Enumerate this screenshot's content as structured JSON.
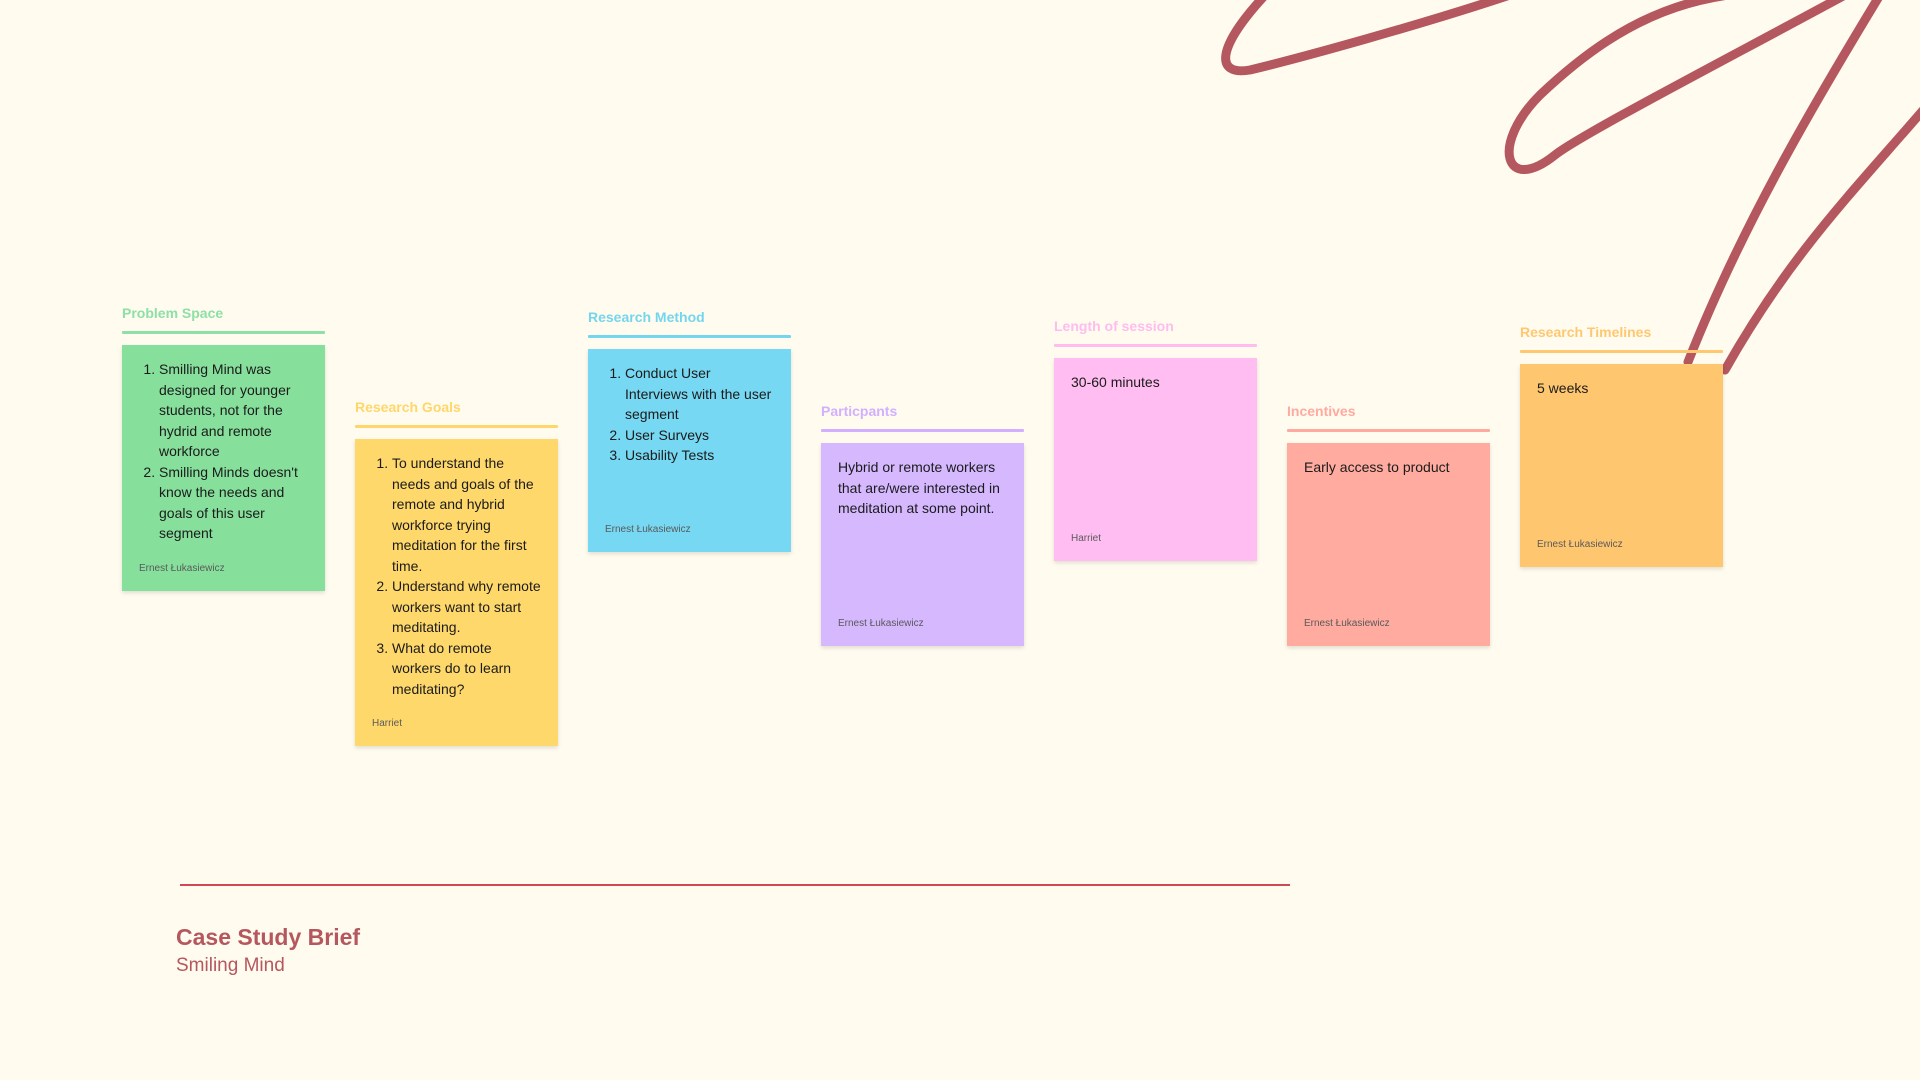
{
  "colors": {
    "background": "#fffbee",
    "scribble": "#b5575e",
    "brief_rule": "#d04a55",
    "brief_text": "#b5575e"
  },
  "columns": [
    {
      "title": "Problem Space",
      "accent": "#8de0a6",
      "note_color": "#86e09c",
      "note": {
        "items": [
          "Smilling Mind was designed for younger students, not for the hydrid and remote workforce",
          "Smilling Minds doesn't know the needs and goals of this user segment"
        ],
        "author": "Ernest Łukasiewicz"
      }
    },
    {
      "title": "Research Goals",
      "accent": "#ffd66b",
      "note_color": "#ffd86b",
      "note": {
        "items": [
          "To understand the needs and goals of the remote and hybrid workforce trying meditation for the first time.",
          "Understand why remote workers want to start meditating.",
          "What do remote workers do to learn meditating?"
        ],
        "author": "Harriet"
      }
    },
    {
      "title": "Research Method",
      "accent": "#74d6ee",
      "note_color": "#76d8f2",
      "note": {
        "items": [
          "Conduct User Interviews with the user segment",
          "User Surveys",
          "Usability Tests"
        ],
        "author": "Ernest Łukasiewicz"
      }
    },
    {
      "title": "Particpants",
      "accent": "#d2b0ff",
      "note_color": "#d6b8ff",
      "note": {
        "text": "Hybrid or remote workers that are/were interested in meditation at some point.",
        "author": "Ernest Łukasiewicz"
      }
    },
    {
      "title": "Length of session",
      "accent": "#ffbcef",
      "note_color": "#ffbdf1",
      "note": {
        "text": "30-60 minutes",
        "author": "Harriet"
      }
    },
    {
      "title": "Incentives",
      "accent": "#ffaaa0",
      "note_color": "#ffaba0",
      "note": {
        "text": "Early access to product",
        "author": "Ernest Łukasiewicz"
      }
    },
    {
      "title": "Research Timelines",
      "accent": "#ffc870",
      "note_color": "#ffc670",
      "note": {
        "text": "5 weeks",
        "author": "Ernest Łukasiewicz"
      }
    }
  ],
  "brief": {
    "title": "Case Study Brief",
    "subtitle": "Smiling Mind"
  }
}
